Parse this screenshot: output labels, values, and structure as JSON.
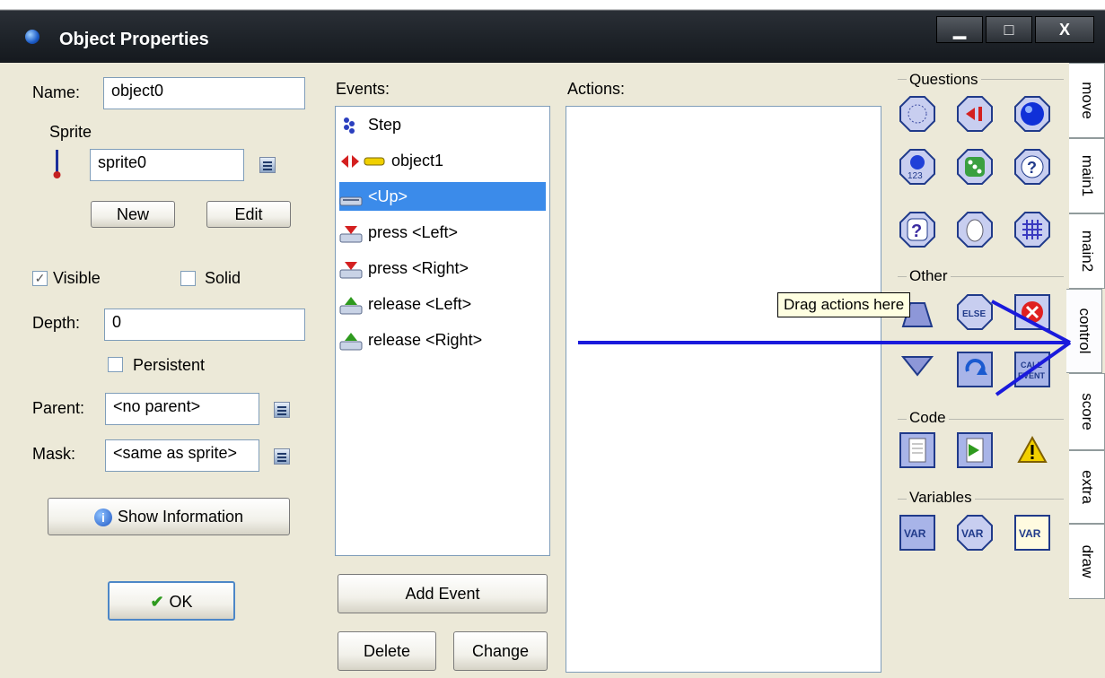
{
  "window": {
    "title": "Object Properties",
    "controls": {
      "minimize": "▁",
      "maximize": "□",
      "close": "X"
    }
  },
  "left": {
    "name_label": "Name:",
    "name_value": "object0",
    "sprite_label": "Sprite",
    "sprite_value": "sprite0",
    "new_button": "New",
    "edit_button": "Edit",
    "visible_label": "Visible",
    "visible_checked": true,
    "solid_label": "Solid",
    "solid_checked": false,
    "depth_label": "Depth:",
    "depth_value": "0",
    "persistent_label": "Persistent",
    "persistent_checked": false,
    "parent_label": "Parent:",
    "parent_value": "<no parent>",
    "mask_label": "Mask:",
    "mask_value": "<same as sprite>",
    "show_info_button": "Show Information",
    "ok_button": "OK"
  },
  "events": {
    "label": "Events:",
    "items": [
      {
        "label": "Step",
        "icon": "step-icon",
        "selected": false
      },
      {
        "label": "object1",
        "icon": "collision-icon",
        "selected": false
      },
      {
        "label": "<Up>",
        "icon": "keyboard-icon",
        "selected": true
      },
      {
        "label": "press <Left>",
        "icon": "key-press-icon",
        "selected": false
      },
      {
        "label": "press <Right>",
        "icon": "key-press-icon",
        "selected": false
      },
      {
        "label": "release <Left>",
        "icon": "key-release-icon",
        "selected": false
      },
      {
        "label": "release <Right>",
        "icon": "key-release-icon",
        "selected": false
      }
    ],
    "add_button": "Add Event",
    "delete_button": "Delete",
    "change_button": "Change"
  },
  "actions": {
    "label": "Actions:",
    "tooltip": "Drag actions here"
  },
  "palette": {
    "questions_label": "Questions",
    "other_label": "Other",
    "code_label": "Code",
    "variables_label": "Variables",
    "else_text": "ELSE",
    "call_event_text": "CALL EVENT",
    "var_text": "VAR"
  },
  "tabs": [
    "move",
    "main1",
    "main2",
    "control",
    "score",
    "extra",
    "draw"
  ],
  "colors": {
    "selection": "#3b8bea",
    "arrow": "#1a1adc",
    "titlebar": "#1f242a"
  }
}
